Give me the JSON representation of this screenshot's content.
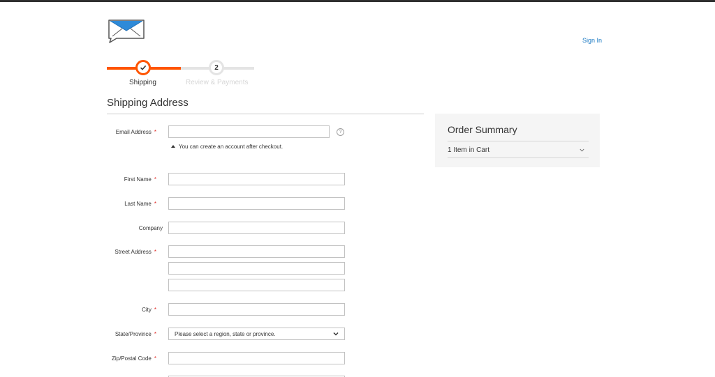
{
  "header": {
    "logo_icon": "envelope-logo-icon",
    "sign_in": "Sign In"
  },
  "progress": {
    "steps": [
      {
        "label": "Shipping",
        "state": "complete"
      },
      {
        "number": "2",
        "label": "Review & Payments",
        "state": "pending"
      }
    ],
    "accent_color": "#ff5501"
  },
  "shipping": {
    "title": "Shipping Address",
    "email": {
      "label": "Email Address",
      "required": "*",
      "value": "",
      "note": "You can create an account after checkout.",
      "help": "?"
    },
    "first_name": {
      "label": "First Name",
      "required": "*",
      "value": ""
    },
    "last_name": {
      "label": "Last Name",
      "required": "*",
      "value": ""
    },
    "company": {
      "label": "Company",
      "value": ""
    },
    "street": {
      "label": "Street Address",
      "required": "*",
      "lines": [
        "",
        "",
        ""
      ]
    },
    "city": {
      "label": "City",
      "required": "*",
      "value": ""
    },
    "region": {
      "label": "State/Province",
      "required": "*",
      "selected": "Please select a region, state or province."
    },
    "zip": {
      "label": "Zip/Postal Code",
      "required": "*",
      "value": ""
    }
  },
  "summary": {
    "title": "Order Summary",
    "items": "1 Item in Cart"
  }
}
